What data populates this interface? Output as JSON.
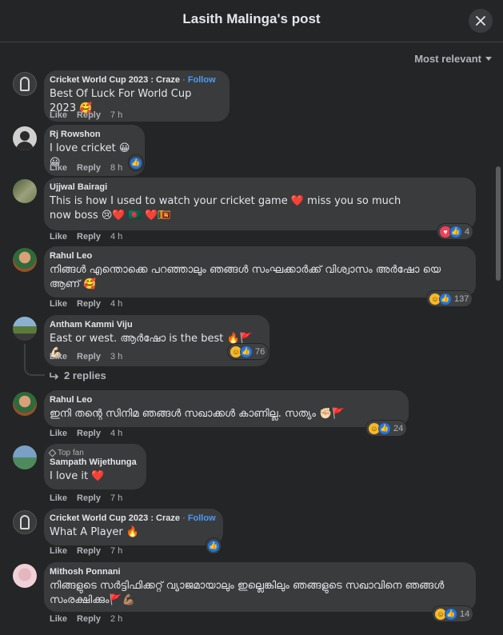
{
  "header": {
    "title": "Lasith Malinga's post",
    "close_icon": "close-icon"
  },
  "sort": {
    "label": "Most relevant"
  },
  "actions": {
    "like": "Like",
    "reply": "Reply"
  },
  "replies_label": "2 replies",
  "colors": {
    "background": "#242526",
    "bubble": "#3a3b3c",
    "follow": "#4b9bf5",
    "like": "#1877f2",
    "love": "#f33e58",
    "haha": "#f7b928"
  },
  "comments": [
    {
      "name": "Cricket World Cup 2023 : Craze",
      "follow": "Follow",
      "text": "Best Of Luck For World Cup 2023 🥰",
      "time": "7 h"
    },
    {
      "name": "Rj Rowshon",
      "text": "I love cricket 😀😀",
      "time": "8 h"
    },
    {
      "name": "Ujjwal Bairagi",
      "text": "This is how I used to watch your cricket game ❤️ miss you so much now boss 😢❤️ 🇧🇩 ❤️🇱🇰",
      "time": "4 h",
      "reaction_count": "4"
    },
    {
      "name": "Rahul Leo",
      "text": "നിങ്ങൾ എന്തൊക്കെ പറഞ്ഞാലും ഞങ്ങൾ സംഘക്കാർക്ക് വിശ്വാസം അർഷോ യെ ആണ് 🥰",
      "time": "4 h",
      "reaction_count": "137"
    },
    {
      "name": "Antham Kammi Viju",
      "text": "East or west. ആർഷോ is the best 🔥🚩💪🏻",
      "time": "3 h",
      "reaction_count": "76"
    },
    {
      "name": "Rahul Leo",
      "text": "ഇനി തന്റെ സിനിമ ഞങ്ങൾ സഖാക്കൾ കാണില്ല. സത്യം ✊🏻🚩",
      "time": "4 h",
      "reaction_count": "24"
    },
    {
      "badge": "Top fan",
      "name": "Sampath Wijethunga",
      "text": "I love it ❤️",
      "time": "7 h"
    },
    {
      "name": "Cricket World Cup 2023 : Craze",
      "follow": "Follow",
      "text": "What A Player 🔥",
      "time": "7 h"
    },
    {
      "name": "Mithosh Ponnani",
      "text": "നിങ്ങളുടെ സർട്ടിഫിക്കറ്റ് വ്യാജമായാലും ഇല്ലെങ്കിലും ഞങ്ങളുടെ സഖാവിനെ ഞങ്ങൾ സംരക്ഷിക്കും🚩💪🏽",
      "time": "2 h",
      "reaction_count": "14"
    }
  ]
}
